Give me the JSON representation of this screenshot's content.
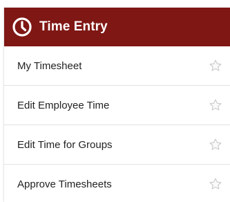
{
  "header": {
    "title": "Time Entry",
    "icon": "clock-icon",
    "bg_color": "#7f1714"
  },
  "menu": {
    "items": [
      {
        "label": "My Timesheet",
        "icon": "star-outline-icon"
      },
      {
        "label": "Edit Employee Time",
        "icon": "star-outline-icon"
      },
      {
        "label": "Edit Time for Groups",
        "icon": "star-outline-icon"
      },
      {
        "label": "Approve Timesheets",
        "icon": "star-outline-icon"
      }
    ]
  }
}
